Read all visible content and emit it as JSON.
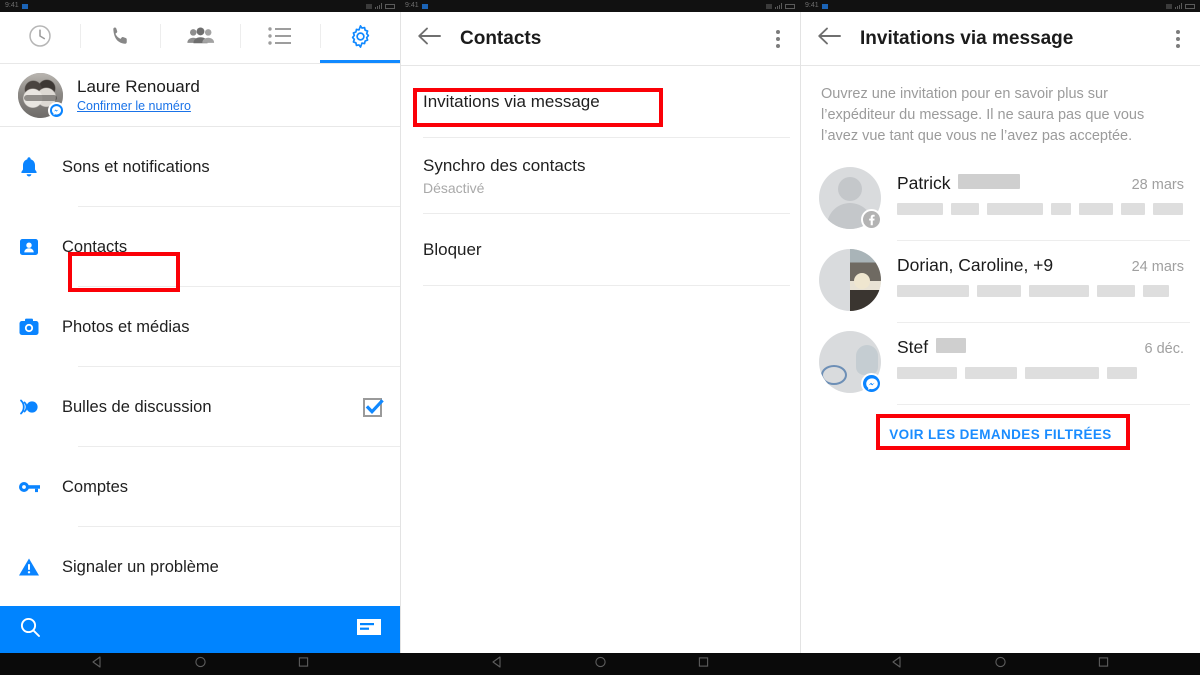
{
  "statusbar": {
    "phones": [
      {
        "time": "9:41",
        "carrier": ""
      },
      {
        "time": "9:41",
        "carrier": ""
      },
      {
        "time": "9:41",
        "carrier": ""
      }
    ]
  },
  "panel_settings": {
    "tabs": [
      {
        "name": "recent",
        "icon": "clock-icon",
        "active": false
      },
      {
        "name": "calls",
        "icon": "phone-icon",
        "active": false
      },
      {
        "name": "groups",
        "icon": "people-icon",
        "active": false
      },
      {
        "name": "list",
        "icon": "list-icon",
        "active": false
      },
      {
        "name": "settings",
        "icon": "gear-icon",
        "active": true
      }
    ],
    "profile": {
      "name": "Laure Renouard",
      "link": "Confirmer le numéro",
      "badge": "messenger-badge"
    },
    "items": [
      {
        "label": "Sons et notifications",
        "icon": "bell-icon",
        "control": "none"
      },
      {
        "label": "Contacts",
        "icon": "contact-card-icon",
        "control": "none",
        "highlighted": true
      },
      {
        "label": "Photos et médias",
        "icon": "camera-icon",
        "control": "none"
      },
      {
        "label": "Bulles de discussion",
        "icon": "chat-heads-icon",
        "control": "checkbox",
        "checked": true
      },
      {
        "label": "Comptes",
        "icon": "key-icon",
        "control": "none"
      },
      {
        "label": "Signaler un problème",
        "icon": "warning-icon",
        "control": "none"
      }
    ],
    "searchbar": {
      "search_icon": "search-icon",
      "compose_icon": "new-message-icon",
      "color": "#0084ff"
    }
  },
  "panel_contacts": {
    "appbar": {
      "back_icon": "back-arrow-icon",
      "title": "Contacts",
      "menu_icon": "overflow-menu-icon"
    },
    "options": [
      {
        "title": "Invitations via message",
        "subtitle": "",
        "highlighted": true
      },
      {
        "title": "Synchro des contacts",
        "subtitle": "Désactivé",
        "highlighted": false
      },
      {
        "title": "Bloquer",
        "subtitle": "",
        "highlighted": false
      }
    ]
  },
  "panel_invitations": {
    "appbar": {
      "back_icon": "back-arrow-icon",
      "title": "Invitations via message",
      "menu_icon": "overflow-menu-icon"
    },
    "intro": "Ouvrez une invitation pour en savoir plus sur l’expéditeur du message. Il ne saura pas que vous l’avez vue tant que vous ne l’avez pas acceptée.",
    "requests": [
      {
        "name": "Patrick",
        "name_redacted": true,
        "date": "28 mars",
        "avatar": "placeholder-avatar",
        "badge": "facebook-badge",
        "preview_redacted": true
      },
      {
        "name": "Dorian, Caroline, +9",
        "name_redacted": false,
        "date": "24 mars",
        "avatar": "group-photo-avatar",
        "badge": "none",
        "preview_redacted": true
      },
      {
        "name": "Stef",
        "name_redacted": true,
        "date": "6 déc.",
        "avatar": "photo-avatar",
        "badge": "messenger-badge",
        "preview_redacted": true
      }
    ],
    "filtered_link": "VOIR LES DEMANDES FILTRÉES",
    "filtered_link_highlighted": true
  },
  "navigation": {
    "buttons": [
      {
        "name": "back-button",
        "icon": "triangle-left-icon"
      },
      {
        "name": "home-button",
        "icon": "circle-icon"
      },
      {
        "name": "recents-button",
        "icon": "square-icon"
      }
    ]
  },
  "annotations": {
    "color": "#fb0007",
    "boxes": [
      {
        "target": "Contacts"
      },
      {
        "target": "Invitations via message"
      },
      {
        "target": "VOIR LES DEMANDES FILTRÉES"
      }
    ]
  }
}
